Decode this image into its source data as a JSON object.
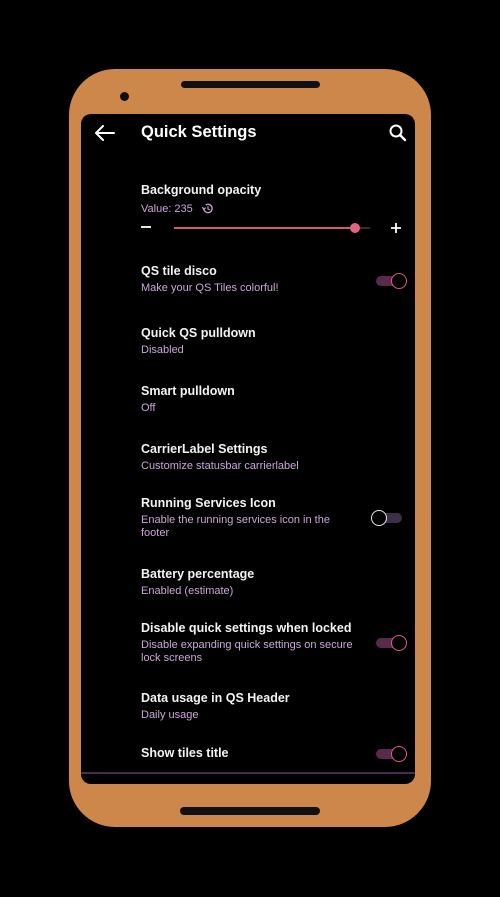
{
  "header": {
    "title": "Quick Settings"
  },
  "colors": {
    "frame": "#cd874a",
    "accent": "#e05a85",
    "subtitle": "#c9a8d6",
    "slider": "#d05a6e"
  },
  "icons": {
    "back": "arrow-left-icon",
    "search": "search-icon",
    "reset": "restore-icon",
    "minus": "minus-icon",
    "plus": "plus-icon"
  },
  "background_opacity": {
    "title": "Background opacity",
    "value_text": "Value: 235",
    "value": 235,
    "max": 255
  },
  "items": [
    {
      "title": "QS tile disco",
      "subtitle": "Make your QS Tiles colorful!",
      "toggle": true
    },
    {
      "title": "Quick QS pulldown",
      "subtitle": "Disabled"
    },
    {
      "title": "Smart pulldown",
      "subtitle": "Off"
    },
    {
      "title": "CarrierLabel Settings",
      "subtitle": "Customize statusbar carrierlabel"
    },
    {
      "title": "Running Services Icon",
      "subtitle": "Enable the running services icon in the footer",
      "toggle": false
    },
    {
      "title": "Battery percentage",
      "subtitle": "Enabled (estimate)"
    },
    {
      "title": "Disable quick settings when locked",
      "subtitle": "Disable expanding quick settings on secure lock screens",
      "toggle": true
    },
    {
      "title": "Data usage in QS Header",
      "subtitle": "Daily usage"
    },
    {
      "title": "Show tiles title",
      "toggle": true
    }
  ]
}
